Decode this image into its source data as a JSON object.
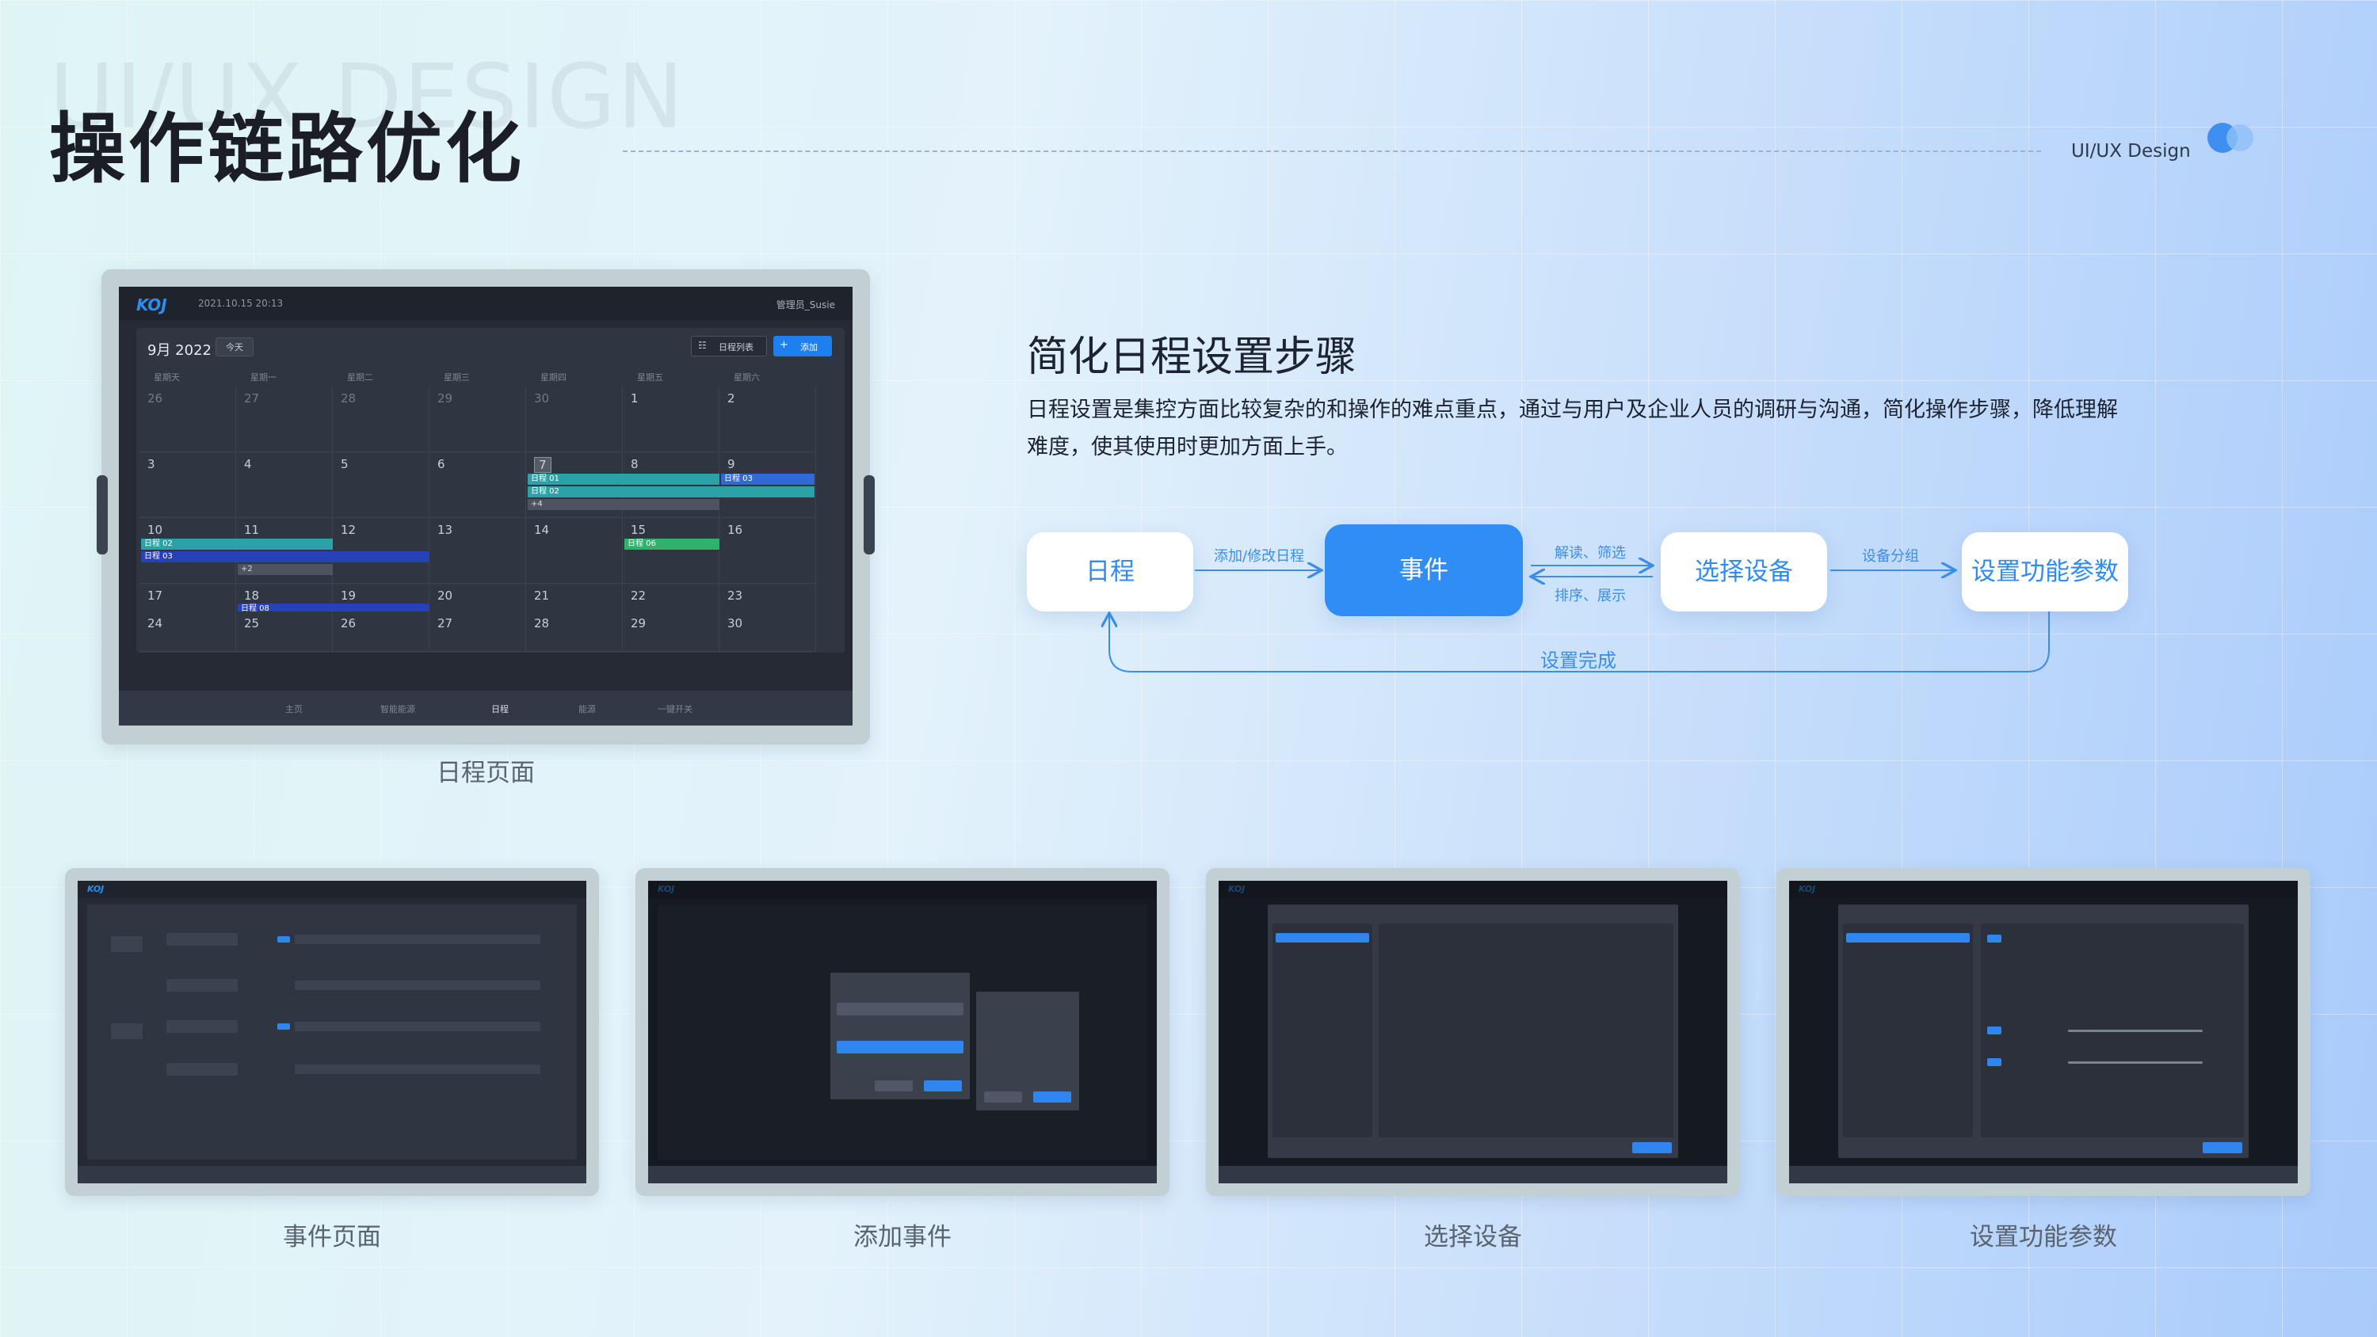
{
  "header": {
    "watermark": "UI/UX DESIGN",
    "title": "操作链路优化",
    "brand": "UI/UX Design"
  },
  "calendar_screen": {
    "logo": "KOJ",
    "datetime": "2021.10.15    20:13",
    "user": "管理员_Susie",
    "month": "9月 2022",
    "today_btn": "今天",
    "list_btn": "日程列表",
    "add_btn": "添加",
    "weekdays": [
      "星期天",
      "星期一",
      "星期二",
      "星期三",
      "星期四",
      "星期五",
      "星期六"
    ],
    "days": [
      "26",
      "27",
      "28",
      "29",
      "30",
      "1",
      "2",
      "3",
      "4",
      "5",
      "6",
      "7",
      "8",
      "9",
      "10",
      "11",
      "12",
      "13",
      "14",
      "15",
      "16",
      "17",
      "18",
      "19",
      "20",
      "21",
      "22",
      "23",
      "24",
      "25",
      "26",
      "27",
      "28",
      "29",
      "30"
    ],
    "events": {
      "e01": "日程 01",
      "e02": "日程 02",
      "e03": "日程 03",
      "e06": "日程 06",
      "e08": "日程 08",
      "more4": "+4",
      "more2": "+2"
    },
    "tabs": [
      "主页",
      "智能能源",
      "日程",
      "能源",
      "一键开关"
    ],
    "caption": "日程页面"
  },
  "flow": {
    "title": "简化日程设置步骤",
    "description": "日程设置是集控方面比较复杂的和操作的难点重点，通过与用户及企业人员的调研与沟通，简化操作步骤，降低理解难度，使其使用时更加方面上手。",
    "nodes": [
      "日程",
      "事件",
      "选择设备",
      "设置功能参数"
    ],
    "labels": {
      "add_edit": "添加/修改日程",
      "read_filter": "解读、筛选",
      "sort_show": "排序、展示",
      "group": "设备分组",
      "done": "设置完成"
    }
  },
  "screens": [
    {
      "caption": "事件页面"
    },
    {
      "caption": "添加事件"
    },
    {
      "caption": "选择设备"
    },
    {
      "caption": "设置功能参数"
    }
  ],
  "colors": {
    "accent": "#2f8df3",
    "screen_bg": "#252a35",
    "event_green": "#2fb36b",
    "event_blue": "#2f6ad6"
  }
}
